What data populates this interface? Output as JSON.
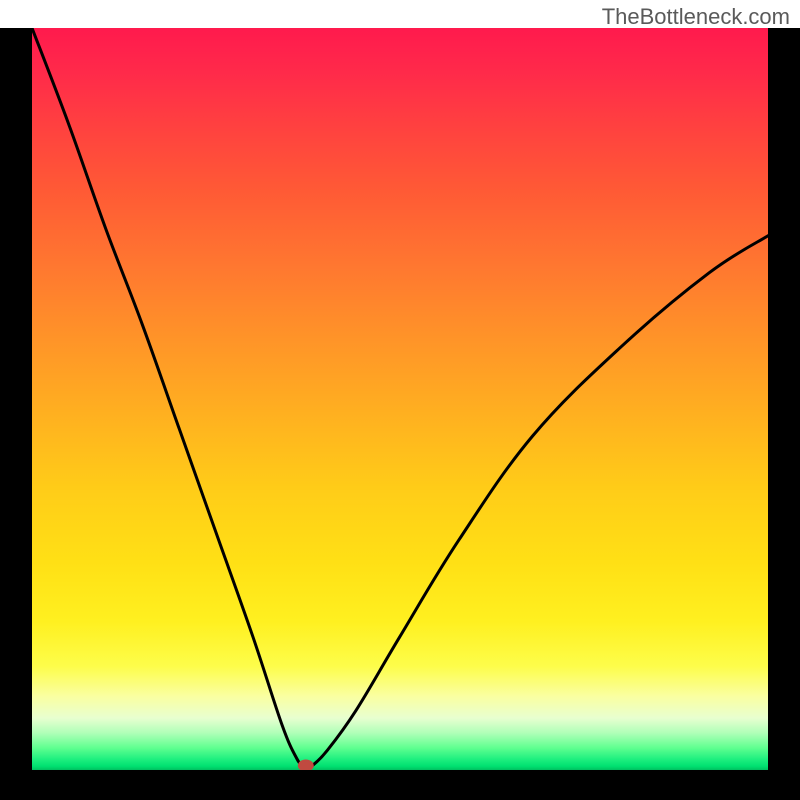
{
  "watermark": "TheBottleneck.com",
  "chart_data": {
    "type": "line",
    "title": "",
    "xlabel": "",
    "ylabel": "",
    "x_range": [
      0,
      100
    ],
    "y_range": [
      0,
      100
    ],
    "series": [
      {
        "name": "bottleneck-curve",
        "x": [
          0,
          5,
          10,
          15,
          20,
          25,
          30,
          34,
          36,
          37,
          37.5,
          38,
          40,
          44,
          50,
          58,
          68,
          80,
          92,
          100
        ],
        "values": [
          100,
          87,
          73,
          60,
          46,
          32,
          18,
          6,
          1.5,
          0.3,
          0,
          0.5,
          2.5,
          8,
          18,
          31,
          45,
          57,
          67,
          72
        ]
      }
    ],
    "marker": {
      "x": 37.2,
      "y": 0.6,
      "color": "#c04a40"
    },
    "gradient": [
      "#ff1a4d",
      "#ff8a2a",
      "#ffe015",
      "#20f080"
    ]
  }
}
